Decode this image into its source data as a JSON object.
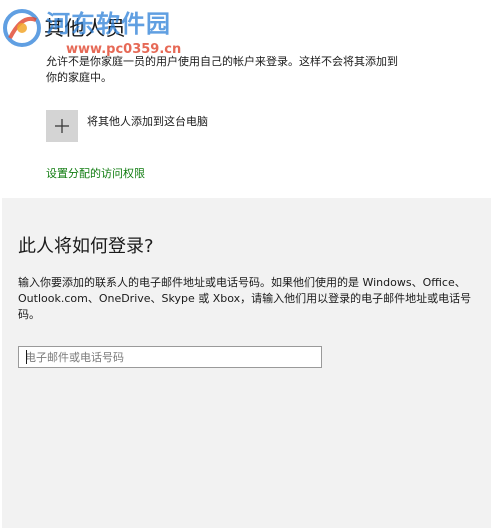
{
  "settings": {
    "title": "其他人员",
    "description": "允许不是你家庭一员的用户使用自己的帐户来登录。这样不会将其添加到你的家庭中。",
    "add_button_label": "将其他人添加到这台电脑",
    "access_link": "设置分配的访问权限"
  },
  "watermark": {
    "name": "河东软件园",
    "url": "www.pc0359.cn"
  },
  "dialog": {
    "title": "此人将如何登录?",
    "description": "输入你要添加的联系人的电子邮件地址或电话号码。如果他们使用的是 Windows、Office、Outlook.com、OneDrive、Skype 或 Xbox，请输入他们用以登录的电子邮件地址或电话号码。",
    "email_value": "",
    "email_placeholder": "电子邮件或电话号码"
  },
  "colors": {
    "accent_link": "#107c10",
    "dialog_background": "#f2f2f2",
    "tile_background": "#d4d4d4"
  },
  "icons": {
    "add_tile": "plus-icon",
    "watermark_logo": "logo-icon"
  }
}
